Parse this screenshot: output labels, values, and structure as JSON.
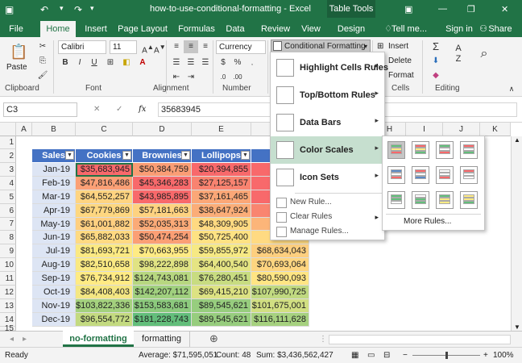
{
  "title_bar": {
    "doc_title": "how-to-use-conditional-formatting - Excel",
    "table_tools": "Table Tools"
  },
  "tabs": [
    "File",
    "Home",
    "Insert",
    "Page Layout",
    "Formulas",
    "Data",
    "Review",
    "View",
    "Design"
  ],
  "tell_me": "Tell me...",
  "sign_in": "Sign in",
  "share": "Share",
  "ribbon": {
    "paste": "Paste",
    "font_name": "Calibri",
    "font_size": "11",
    "number_format": "Currency",
    "conditional_formatting": "Conditional Formatting",
    "insert": "Insert",
    "delete": "Delete",
    "format": "Format",
    "groups": {
      "clipboard": "Clipboard",
      "font": "Font",
      "alignment": "Alignment",
      "number": "Number",
      "cells": "Cells",
      "editing": "Editing"
    }
  },
  "formula_bar": {
    "name_box": "C3",
    "cancel": "✕",
    "confirm": "✓",
    "fx": "fx",
    "value": "35683945"
  },
  "columns": [
    "A",
    "B",
    "C",
    "D",
    "E",
    "F",
    "G",
    "H",
    "I",
    "J",
    "K"
  ],
  "rows": [
    "1",
    "2",
    "3",
    "4",
    "5",
    "6",
    "7",
    "8",
    "9",
    "10",
    "11",
    "12",
    "13",
    "14",
    "15",
    "16"
  ],
  "table": {
    "headers": [
      "Sales",
      "Cookies",
      "Brownies",
      "Lollipops",
      ""
    ],
    "rows": [
      {
        "month": "Jan-19",
        "values": [
          "$35,683,945",
          "$50,384,759",
          "$20,394,855",
          "$36"
        ],
        "colors": [
          "#f8696b",
          "#fa9d75",
          "#f8696b",
          "#f8696b"
        ]
      },
      {
        "month": "Feb-19",
        "values": [
          "$47,816,486",
          "$45,346,283",
          "$27,125,157",
          "$36"
        ],
        "colors": [
          "#fba076",
          "#f8696b",
          "#f98370",
          "#f8696b"
        ]
      },
      {
        "month": "Mar-19",
        "values": [
          "$64,552,257",
          "$43,985,895",
          "$37,161,465",
          "$36"
        ],
        "colors": [
          "#ffd481",
          "#f8696b",
          "#fba777",
          "#f8696b"
        ]
      },
      {
        "month": "Apr-19",
        "values": [
          "$67,779,869",
          "$57,181,663",
          "$38,647,924",
          "$43"
        ],
        "colors": [
          "#fed780",
          "#fed280",
          "#fbad78",
          "#f98570"
        ]
      },
      {
        "month": "May-19",
        "values": [
          "$61,001,882",
          "$52,035,313",
          "$48,309,905",
          "$60"
        ],
        "colors": [
          "#ffcf80",
          "#fbaa77",
          "#ffd981",
          "#fcb579"
        ]
      },
      {
        "month": "Jun-19",
        "values": [
          "$65,882,033",
          "$50,474,254",
          "$50,725,400",
          "$73"
        ],
        "colors": [
          "#ffda82",
          "#fb9f75",
          "#fee283",
          "#ffda82"
        ]
      },
      {
        "month": "Jul-19",
        "values": [
          "$81,693,721",
          "$70,663,955",
          "$59,855,972",
          "$68,634,043"
        ],
        "colors": [
          "#fbe983",
          "#ffeb84",
          "#f6e984",
          "#fdcf7f"
        ]
      },
      {
        "month": "Aug-19",
        "values": [
          "$82,510,658",
          "$98,222,898",
          "$64,400,540",
          "$70,693,064"
        ],
        "colors": [
          "#fae983",
          "#e0e383",
          "#e5e483",
          "#fed580"
        ]
      },
      {
        "month": "Sep-19",
        "values": [
          "$76,734,912",
          "$124,743,081",
          "$76,280,451",
          "$80,590,093"
        ],
        "colors": [
          "#ffeb84",
          "#b7d780",
          "#c8dc81",
          "#ffe584"
        ]
      },
      {
        "month": "Oct-19",
        "values": [
          "$84,408,403",
          "$142,207,112",
          "$69,415,210",
          "$107,990,725"
        ],
        "colors": [
          "#f4e783",
          "#a0d07e",
          "#dde283",
          "#c0d980"
        ]
      },
      {
        "month": "Nov-19",
        "values": [
          "$103,822,336",
          "$153,583,681",
          "$89,545,621",
          "$101,675,001"
        ],
        "colors": [
          "#a4d17e",
          "#8cca7d",
          "#97cd7e",
          "#d1df82"
        ]
      },
      {
        "month": "Dec-19",
        "values": [
          "$96,554,772",
          "$181,228,743",
          "$89,545,621",
          "$116,111,628"
        ],
        "colors": [
          "#c3da80",
          "#63be7b",
          "#97cd7e",
          "#a6d17f"
        ]
      }
    ]
  },
  "cf_menu": {
    "items": [
      "Highlight Cells Rules",
      "Top/Bottom Rules",
      "Data Bars",
      "Color Scales",
      "Icon Sets"
    ],
    "sub": [
      "New Rule...",
      "Clear Rules",
      "Manage Rules..."
    ]
  },
  "color_scales": {
    "more_rules": "More Rules...",
    "swatches": [
      [
        "#63be7b",
        "#ffeb84",
        "#f8696b"
      ],
      [
        "#f8696b",
        "#ffeb84",
        "#63be7b"
      ],
      [
        "#63be7b",
        "#ffffff",
        "#f8696b"
      ],
      [
        "#f8696b",
        "#ffffff",
        "#63be7b"
      ],
      [
        "#5a8ac6",
        "#ffffff",
        "#f8696b"
      ],
      [
        "#f8696b",
        "#ffffff",
        "#5a8ac6"
      ],
      [
        "#ffffff",
        "#ffffff",
        "#f8696b"
      ],
      [
        "#f8696b",
        "#ffffff",
        "#ffffff"
      ],
      [
        "#63be7b",
        "#63be7b",
        "#ffffff"
      ],
      [
        "#ffffff",
        "#63be7b",
        "#63be7b"
      ],
      [
        "#63be7b",
        "#ffeb84",
        "#ffeb84"
      ],
      [
        "#ffeb84",
        "#ffeb84",
        "#63be7b"
      ]
    ]
  },
  "sheets": [
    "no-formatting",
    "formatting"
  ],
  "status": {
    "ready": "Ready",
    "average": "Average: $71,595,051",
    "count": "Count: 48",
    "sum": "Sum: $3,436,562,427",
    "zoom": "100%"
  }
}
